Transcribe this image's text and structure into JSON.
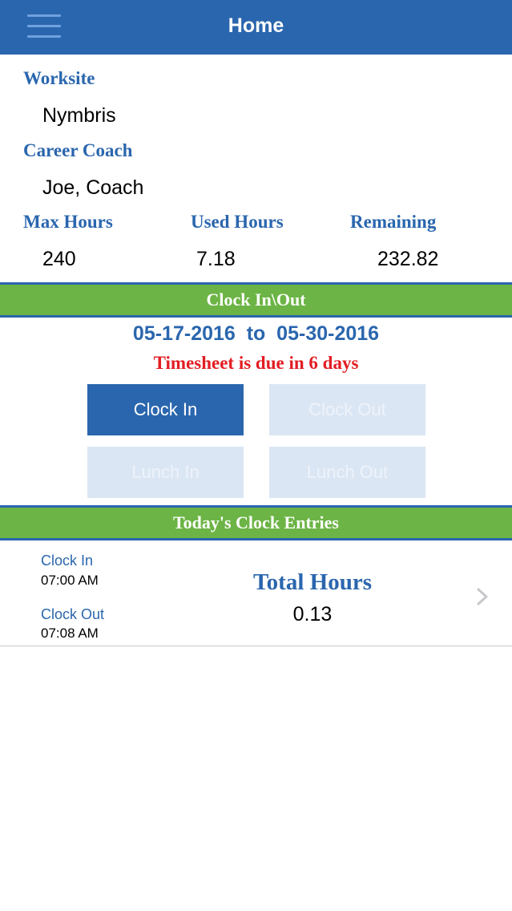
{
  "nav": {
    "title": "Home"
  },
  "info": {
    "worksite_label": "Worksite",
    "worksite_value": "Nymbris",
    "coach_label": "Career Coach",
    "coach_value": "Joe, Coach",
    "max_label": "Max Hours",
    "max_value": "240",
    "used_label": "Used Hours",
    "used_value": "7.18",
    "remaining_label": "Remaining",
    "remaining_value": "232.82"
  },
  "clock": {
    "section_title": "Clock In\\Out",
    "date_range": "05-17-2016  to  05-30-2016",
    "due_message": "Timesheet is due in 6 days",
    "buttons": {
      "clock_in": "Clock In",
      "clock_out": "Clock Out",
      "lunch_in": "Lunch In",
      "lunch_out": "Lunch Out"
    }
  },
  "entries": {
    "section_title": "Today's Clock Entries",
    "items": [
      {
        "clock_in_label": "Clock In",
        "clock_in_time": "07:00 AM",
        "clock_out_label": "Clock Out",
        "clock_out_time": "07:08 AM",
        "total_label": "Total Hours",
        "total_value": "0.13"
      }
    ]
  },
  "colors": {
    "primary": "#2a66ae",
    "section_bar": "#6cb445",
    "alert": "#e21d23",
    "disabled_button": "#dbe6f4"
  },
  "icons": {
    "menu": "hamburger-icon",
    "row_chevron": "chevron-right-icon"
  }
}
